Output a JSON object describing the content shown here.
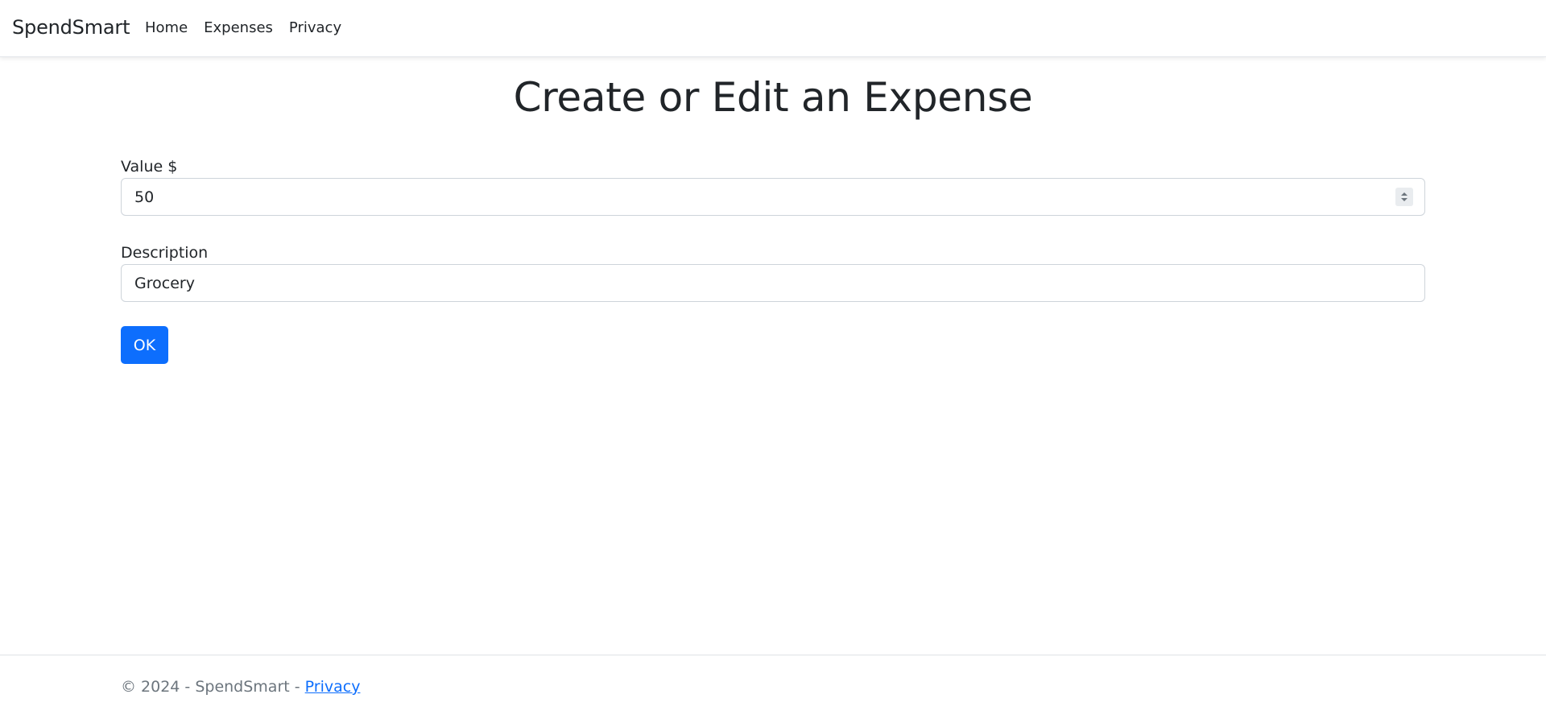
{
  "navbar": {
    "brand": "SpendSmart",
    "links": [
      {
        "label": "Home"
      },
      {
        "label": "Expenses"
      },
      {
        "label": "Privacy"
      }
    ]
  },
  "main": {
    "title": "Create or Edit an Expense",
    "value_field": {
      "label": "Value $",
      "value": "50"
    },
    "description_field": {
      "label": "Description",
      "value": "Grocery"
    },
    "ok_button": "OK"
  },
  "footer": {
    "text": "© 2024 - SpendSmart - ",
    "link": "Privacy"
  },
  "colors": {
    "primary": "#0d6efd",
    "text": "#212529",
    "muted": "#6c757d",
    "border": "#ced4da"
  }
}
